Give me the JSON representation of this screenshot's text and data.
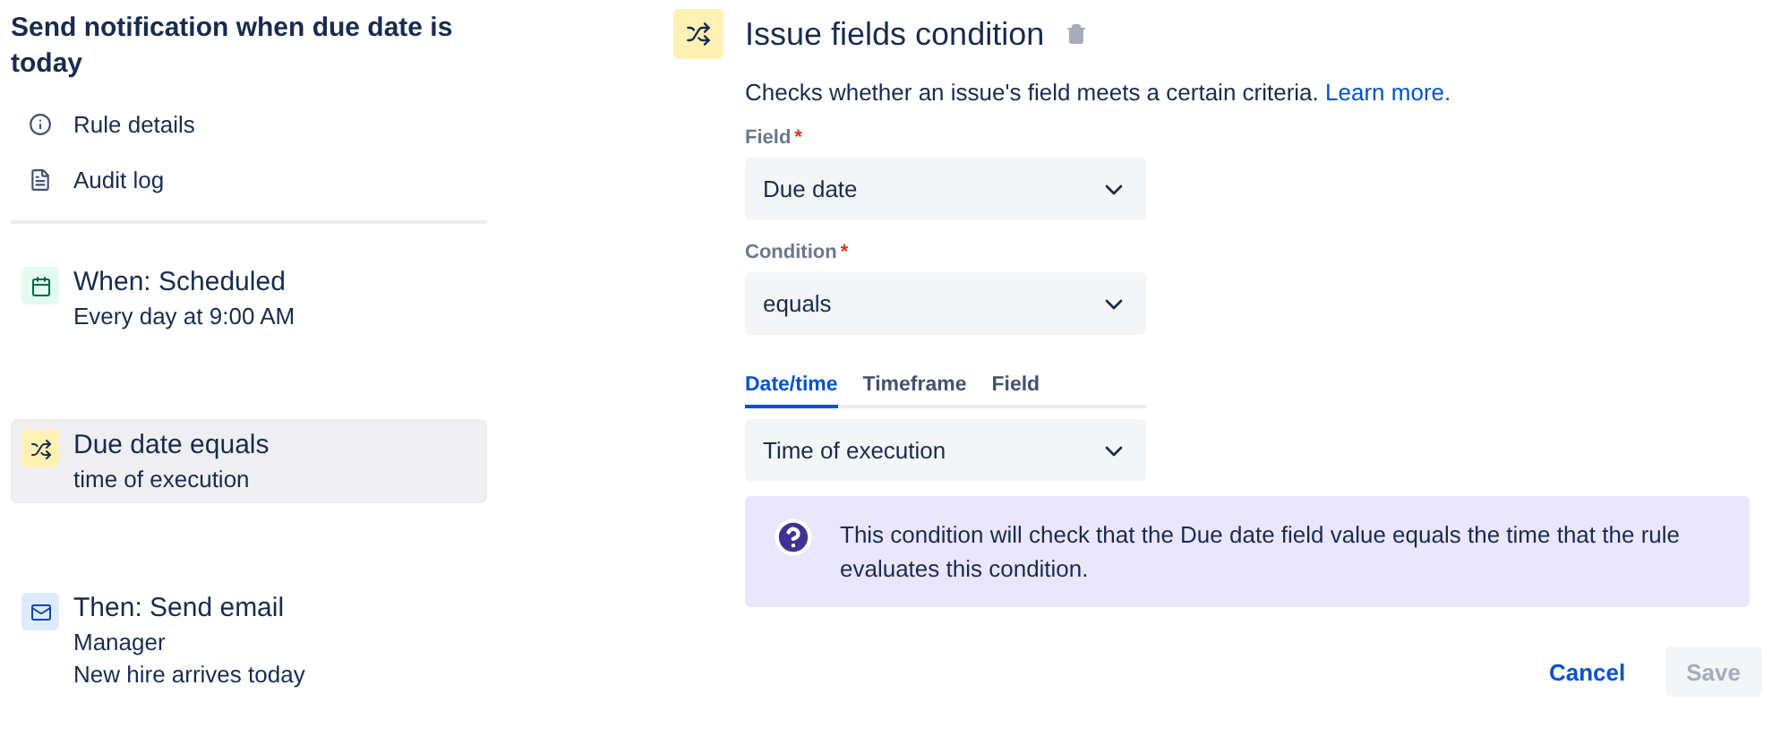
{
  "sidebar": {
    "title": "Send notification when due date is today",
    "links": [
      {
        "kind": "info",
        "label": "Rule details"
      },
      {
        "kind": "log",
        "label": "Audit log"
      }
    ],
    "steps": [
      {
        "kind": "trigger",
        "title": "When: Scheduled",
        "lines": [
          "Every day at 9:00 AM"
        ],
        "selected": false
      },
      {
        "kind": "condition",
        "title": "Due date equals",
        "lines": [
          "time of execution"
        ],
        "selected": true
      },
      {
        "kind": "action",
        "title": "Then: Send email",
        "lines": [
          "Manager",
          "New hire arrives today"
        ],
        "selected": false
      }
    ]
  },
  "panel": {
    "title": "Issue fields condition",
    "description": "Checks whether an issue's field meets a certain criteria.",
    "learn_more": "Learn more.",
    "fields": [
      {
        "label": "Field",
        "required": "*",
        "value": "Due date"
      },
      {
        "label": "Condition",
        "required": "*",
        "value": "equals"
      }
    ],
    "tabs": [
      {
        "label": "Date/time",
        "selected": true
      },
      {
        "label": "Timeframe",
        "selected": false
      },
      {
        "label": "Field",
        "selected": false
      }
    ],
    "tab_select": {
      "value": "Time of execution"
    },
    "info": "This condition will check that the Due date field value equals the time that the rule evaluates this condition.",
    "buttons": [
      {
        "label": "Cancel",
        "disabled": false,
        "kind": "link"
      },
      {
        "label": "Save",
        "disabled": true,
        "kind": "primary"
      }
    ]
  }
}
